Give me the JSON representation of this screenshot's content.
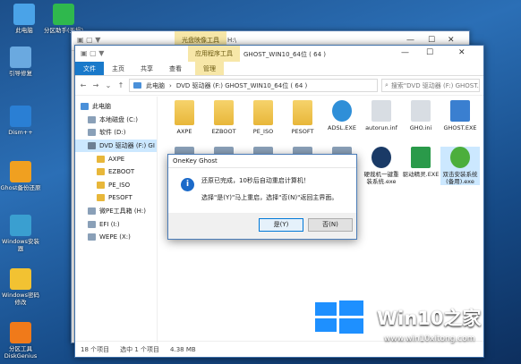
{
  "desktop": {
    "icons": [
      {
        "label": "此电脑",
        "icon": "computer-icon",
        "color": "#4aa3e8"
      },
      {
        "label": "分区助手(无损)",
        "icon": "partition-icon",
        "color": "#2fb84d"
      },
      {
        "label": "引导修复",
        "icon": "repair-tool-icon",
        "color": "#6aa9e0"
      },
      {
        "label": "Dism++",
        "icon": "gear-icon",
        "color": "#2a7fd4"
      },
      {
        "label": "Ghost备份还原",
        "icon": "ghost-icon",
        "color": "#f0a020"
      },
      {
        "label": "Windows安装器",
        "icon": "installer-icon",
        "color": "#3a9fd0"
      },
      {
        "label": "Windows密码修改",
        "icon": "key-icon",
        "color": "#f2c232"
      },
      {
        "label": "分区工具 DiskGenius",
        "icon": "diskgenius-icon",
        "color": "#f07a1a"
      }
    ]
  },
  "back_window": {
    "context_tab": "光盘映像工具",
    "path": "H:\\"
  },
  "window": {
    "context_header": "应用程序工具",
    "title": "GHOST_WIN10_64位 ( 64 )",
    "tabs": {
      "file": "文件",
      "home": "主页",
      "share": "共享",
      "view": "查看",
      "manage": "管理"
    },
    "address": [
      "此电脑",
      "DVD 驱动器 (F:) GHOST_WIN10_64位 ( 64 )"
    ],
    "search_placeholder": "搜索\"DVD 驱动器 (F:) GHOST..."
  },
  "nav_items": [
    {
      "label": "此电脑",
      "icon": "computer-icon",
      "color": "#4a90d9"
    },
    {
      "label": "本地磁盘 (C:)",
      "icon": "drive-icon",
      "color": "#8aa0b8"
    },
    {
      "label": "软件 (D:)",
      "icon": "drive-icon",
      "color": "#8aa0b8"
    },
    {
      "label": "DVD 驱动器 (F:) GI",
      "icon": "dvd-icon",
      "color": "#6d7f93",
      "selected": true
    },
    {
      "label": "AXPE",
      "icon": "folder-icon",
      "color": "#e8b73a"
    },
    {
      "label": "EZBOOT",
      "icon": "folder-icon",
      "color": "#e8b73a"
    },
    {
      "label": "PE_ISO",
      "icon": "folder-icon",
      "color": "#e8b73a"
    },
    {
      "label": "PESOFT",
      "icon": "folder-icon",
      "color": "#e8b73a"
    },
    {
      "label": "微PE工具箱 (H:)",
      "icon": "drive-icon",
      "color": "#8aa0b8"
    },
    {
      "label": "EFI (I:)",
      "icon": "drive-icon",
      "color": "#8aa0b8"
    },
    {
      "label": "WEPE (X:)",
      "icon": "drive-icon",
      "color": "#8aa0b8"
    }
  ],
  "files": [
    {
      "name": "AXPE",
      "icon": "folder-icon"
    },
    {
      "name": "EZBOOT",
      "icon": "folder-icon"
    },
    {
      "name": "PE_ISO",
      "icon": "folder-icon"
    },
    {
      "name": "PESOFT",
      "icon": "folder-icon"
    },
    {
      "name": "ADSL.EXE",
      "icon": "network-globe-icon"
    },
    {
      "name": "autorun.inf",
      "icon": "settings-file-icon"
    },
    {
      "name": "GHO.ini",
      "icon": "settings-file-icon"
    },
    {
      "name": "GHOST.EXE",
      "icon": "window-exe-icon"
    },
    {
      "name": "",
      "icon": "app-icon"
    },
    {
      "name": "",
      "icon": "app-icon"
    },
    {
      "name": "",
      "icon": "app-icon"
    },
    {
      "name": "",
      "icon": "app-icon"
    },
    {
      "name": "",
      "icon": "app-icon"
    },
    {
      "name": "硬裁机一键重装系统.exe",
      "icon": "eye-app-icon"
    },
    {
      "name": "驱动精灵.EXE",
      "icon": "driver-icon"
    },
    {
      "name": "双击安装系统(备用).exe",
      "icon": "install-app-icon",
      "selected": true
    }
  ],
  "status": {
    "count": "18 个项目",
    "selected": "选中 1 个项目",
    "size": "4.38 MB"
  },
  "dialog": {
    "title": "OneKey Ghost",
    "message_line1": "还原已完成，10秒后自动重启计算机！",
    "message_line2": "选择\"是(Y)\"马上重启，选择\"否(N)\"返回主界面。",
    "yes_label": "是(Y)",
    "no_label": "否(N)"
  },
  "watermark": {
    "brand": "Win10之家",
    "url": "www.win10xitong.com",
    "colors": [
      "#1e90ff",
      "#1e90ff",
      "#1e90ff",
      "#1e90ff"
    ]
  }
}
